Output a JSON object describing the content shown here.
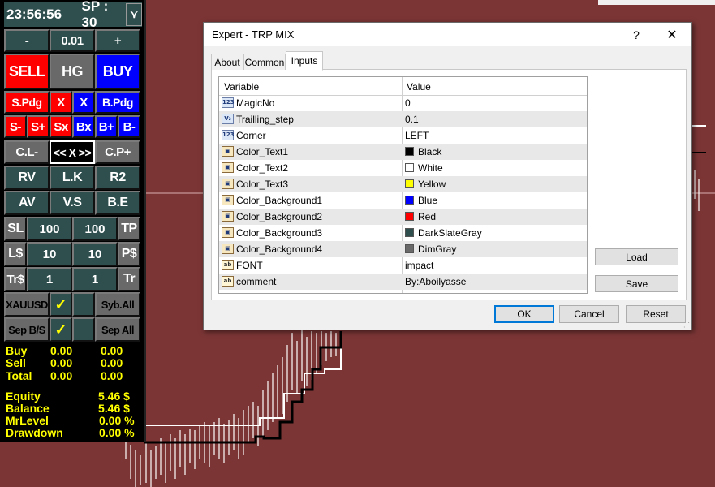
{
  "panel": {
    "clock": "23:56:56",
    "spread": "SP : 30",
    "lot": {
      "minus": "-",
      "value": "0.01",
      "plus": "+"
    },
    "main_buttons": {
      "sell": "SELL",
      "hedge": "HG",
      "buy": "BUY"
    },
    "row_pdg": {
      "s_pdg": "S.Pdg",
      "x1": "X",
      "x2": "X",
      "b_pdg": "B.Pdg"
    },
    "row_adjust": {
      "s_minus": "S-",
      "s_plus": "S+",
      "sx": "Sx",
      "bx": "Bx",
      "b_plus": "B+",
      "b_minus": "B-"
    },
    "row_close": {
      "cl_minus": "C.L-",
      "close_all": "<< X >>",
      "cp_plus": "C.P+"
    },
    "row_rv": {
      "rv": "RV",
      "lk": "L.K",
      "r2": "R2"
    },
    "row_av": {
      "av": "AV",
      "vs": "V.S",
      "be": "B.E"
    },
    "sl_row": {
      "label_left": "SL",
      "value_left": "100",
      "value_right": "100",
      "label_right": "TP"
    },
    "money_row": {
      "label_left": "L$",
      "value_left": "10",
      "value_right": "10",
      "label_right": "P$"
    },
    "trail_row": {
      "label_left": "Tr$",
      "value_left": "1",
      "value_right": "1",
      "label_right": "Tr"
    },
    "symbol_row": {
      "symbol": "XAUUSD",
      "check": "✓",
      "sym_all": "Syb.All"
    },
    "sep_row": {
      "sep": "Sep B/S",
      "check": "✓",
      "sep_all": "Sep All"
    },
    "stats": {
      "buy_label": "Buy",
      "buy_lots": "0.00",
      "buy_profit": "0.00",
      "sell_label": "Sell",
      "sell_lots": "0.00",
      "sell_profit": "0.00",
      "total_label": "Total",
      "total_lots": "0.00",
      "total_profit": "0.00",
      "equity_label": "Equity",
      "equity_value": "5.46 $",
      "balance_label": "Balance",
      "balance_value": "5.46 $",
      "mrlevel_label": "MrLevel",
      "mrlevel_value": "0.00 %",
      "drawdown_label": "Drawdown",
      "drawdown_value": "0.00 %"
    }
  },
  "dialog": {
    "title": "Expert - TRP MIX",
    "help": "?",
    "close": "✕",
    "tabs": [
      "About",
      "Common",
      "Inputs"
    ],
    "active_tab": "Inputs",
    "columns": {
      "variable": "Variable",
      "value": "Value"
    },
    "rows": [
      {
        "icon": "123",
        "name": "MagicNo",
        "value": "0"
      },
      {
        "icon": "V2",
        "name": "Trailling_step",
        "value": "0.1"
      },
      {
        "icon": "123",
        "name": "Corner",
        "value": "LEFT"
      },
      {
        "icon": "clr",
        "name": "Color_Text1",
        "value": "Black",
        "color": "#000000"
      },
      {
        "icon": "clr",
        "name": "Color_Text2",
        "value": "White",
        "color": "#ffffff"
      },
      {
        "icon": "clr",
        "name": "Color_Text3",
        "value": "Yellow",
        "color": "#ffff00"
      },
      {
        "icon": "clr",
        "name": "Color_Background1",
        "value": "Blue",
        "color": "#0000ff"
      },
      {
        "icon": "clr",
        "name": "Color_Background2",
        "value": "Red",
        "color": "#ff0000"
      },
      {
        "icon": "clr",
        "name": "Color_Background3",
        "value": "DarkSlateGray",
        "color": "#2f4f4f"
      },
      {
        "icon": "clr",
        "name": "Color_Background4",
        "value": "DimGray",
        "color": "#696969"
      },
      {
        "icon": "ab",
        "name": "FONT",
        "value": "impact"
      },
      {
        "icon": "ab",
        "name": "comment",
        "value": "By:Aboilyasse"
      }
    ],
    "buttons": {
      "load": "Load",
      "save": "Save",
      "ok": "OK",
      "cancel": "Cancel",
      "reset": "Reset"
    }
  },
  "colors": {
    "chart_bg": "#7b3535",
    "panel_slate": "#2f4f4f",
    "panel_gray": "#696969",
    "stats_text": "#ffff00"
  }
}
